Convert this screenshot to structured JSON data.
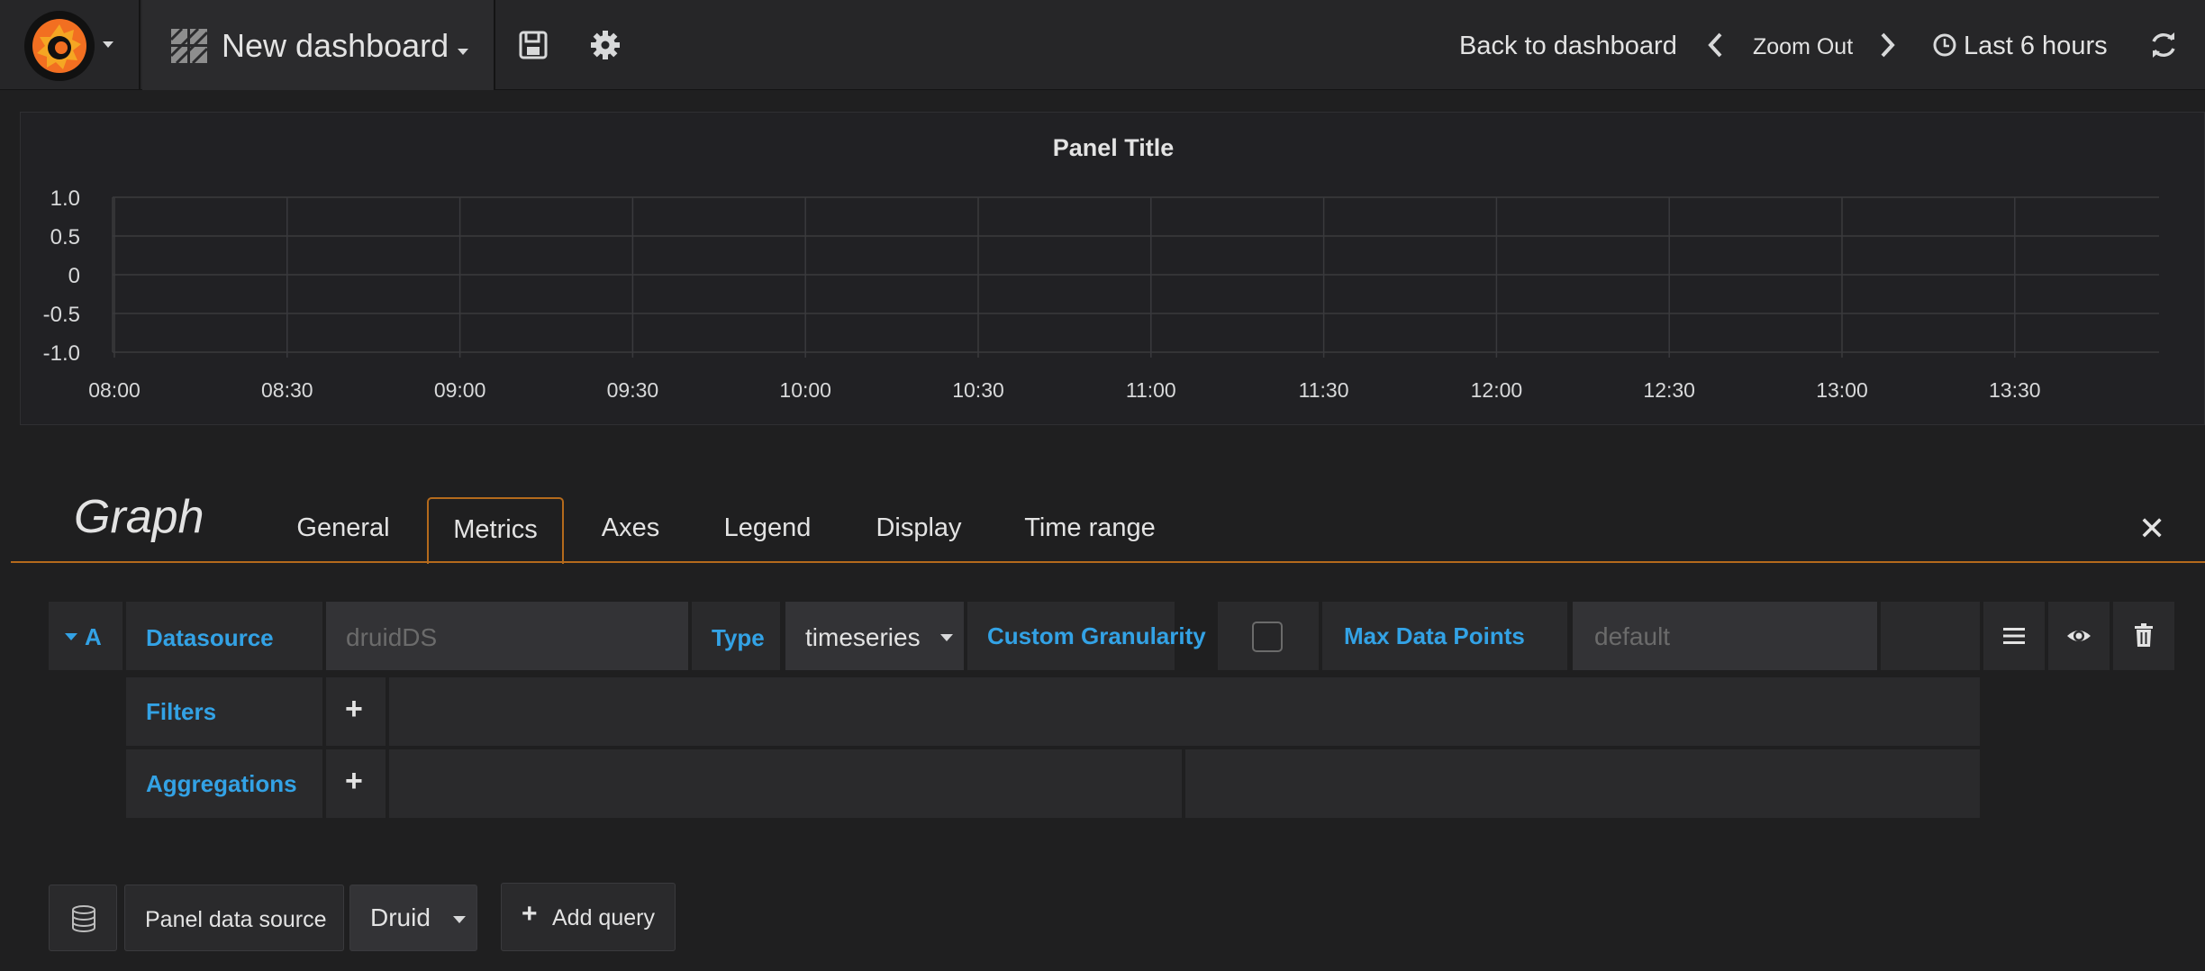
{
  "navbar": {
    "dashboard_title": "New dashboard",
    "back_to_dashboard": "Back to dashboard",
    "zoom_out": "Zoom Out",
    "time_range": "Last 6 hours",
    "icons": [
      "grafana-logo-icon",
      "dashboard-grid-icon",
      "save-icon",
      "settings-icon",
      "chevron-left-icon",
      "chevron-right-icon",
      "clock-icon",
      "refresh-icon"
    ]
  },
  "panel": {
    "title": "Panel Title"
  },
  "chart_data": {
    "type": "line",
    "title": "Panel Title",
    "x_ticks": [
      "08:00",
      "08:30",
      "09:00",
      "09:30",
      "10:00",
      "10:30",
      "11:00",
      "11:30",
      "12:00",
      "12:30",
      "13:00",
      "13:30"
    ],
    "y_ticks": [
      "1.0",
      "0.5",
      "0",
      "-0.5",
      "-1.0"
    ],
    "ylim": [
      -1.0,
      1.0
    ],
    "series": [],
    "grid": true
  },
  "editor": {
    "panel_type": "Graph",
    "tabs": [
      {
        "label": "General",
        "active": false
      },
      {
        "label": "Metrics",
        "active": true
      },
      {
        "label": "Axes",
        "active": false
      },
      {
        "label": "Legend",
        "active": false
      },
      {
        "label": "Display",
        "active": false
      },
      {
        "label": "Time range",
        "active": false
      }
    ],
    "query": {
      "ref_id": "A",
      "datasource_label": "Datasource",
      "datasource_placeholder": "druidDS",
      "type_label": "Type",
      "type_value": "timeseries",
      "custom_granularity_label": "Custom Granularity",
      "max_data_points_label": "Max Data Points",
      "max_data_points_placeholder": "default",
      "filters_label": "Filters",
      "aggregations_label": "Aggregations"
    },
    "footer": {
      "panel_data_source_label": "Panel data source",
      "data_source_value": "Druid",
      "add_query_label": "Add query"
    }
  },
  "colors": {
    "background": "#1f1f20",
    "accent_orange": "#b46a1c",
    "label_blue": "#33a2e5"
  }
}
